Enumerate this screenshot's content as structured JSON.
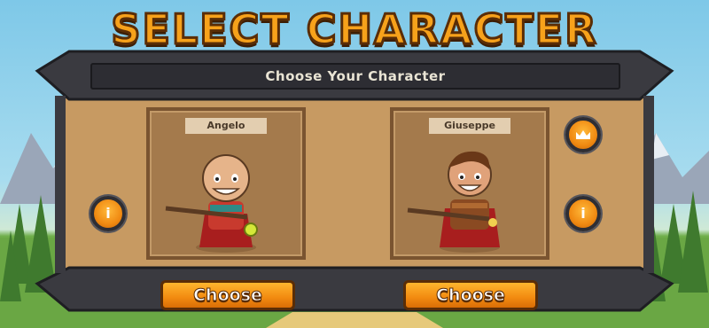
{
  "header": {
    "title": "SELECT CHARACTER"
  },
  "panel": {
    "subtitle": "Choose Your Character"
  },
  "characters": [
    {
      "name": "Angelo",
      "choose_label": "Choose",
      "info_label": "i"
    },
    {
      "name": "Giuseppe",
      "choose_label": "Choose",
      "info_label": "i"
    }
  ],
  "icons": {
    "info": "info-icon",
    "crown": "crown-icon"
  },
  "colors": {
    "accent": "#f08a12",
    "panel_frame": "#3a3a40",
    "parchment": "#c79a62"
  }
}
